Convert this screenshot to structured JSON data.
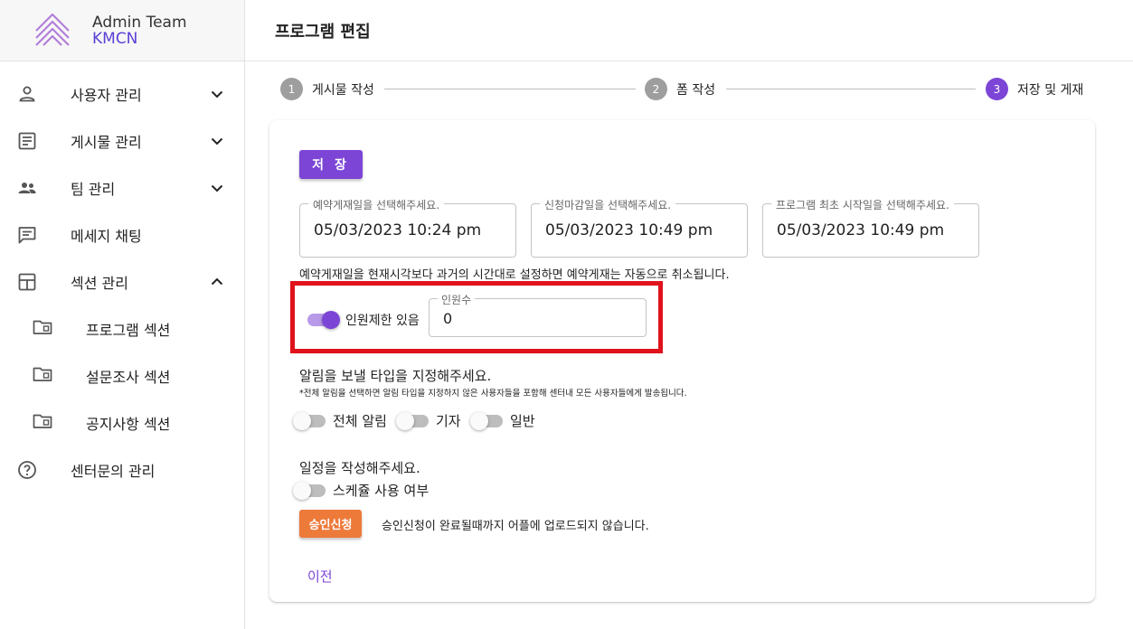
{
  "brand": {
    "title": "Admin Team",
    "subtitle": "KMCN"
  },
  "colors": {
    "accent": "#7c45d6",
    "approve": "#ee7a3a",
    "highlight": "#e0121c"
  },
  "sidebar": {
    "items": [
      {
        "label": "사용자 관리",
        "icon": "person-icon",
        "expanded": false
      },
      {
        "label": "게시물 관리",
        "icon": "article-icon",
        "expanded": false
      },
      {
        "label": "팀 관리",
        "icon": "group-icon",
        "expanded": false
      },
      {
        "label": "메세지 채팅",
        "icon": "chat-icon"
      },
      {
        "label": "섹션 관리",
        "icon": "dashboard-icon",
        "expanded": true
      },
      {
        "label": "센터문의 관리",
        "icon": "help-icon"
      }
    ],
    "sub_items": [
      {
        "label": "프로그램 섹션",
        "icon": "folder-icon"
      },
      {
        "label": "설문조사 섹션",
        "icon": "folder-icon"
      },
      {
        "label": "공지사항 섹션",
        "icon": "folder-icon"
      }
    ]
  },
  "header": {
    "title": "프로그램 편집"
  },
  "stepper": {
    "steps": [
      {
        "num": "1",
        "label": "게시물 작성",
        "state": "done"
      },
      {
        "num": "2",
        "label": "폼 작성",
        "state": "done"
      },
      {
        "num": "3",
        "label": "저장 및 게재",
        "state": "active"
      }
    ]
  },
  "form": {
    "save_label": "저 장",
    "fields": [
      {
        "label": "예약게재일을 선택해주세요.",
        "value": "05/03/2023 10:24 pm"
      },
      {
        "label": "신청마감일을 선택해주세요.",
        "value": "05/03/2023 10:49 pm"
      },
      {
        "label": "프로그램 최초 시작일을 선택해주세요.",
        "value": "05/03/2023 10:49 pm"
      }
    ],
    "notice": "예약게재일을 현재시각보다 과거의 시간대로 설정하면 예약게재는 자동으로 취소됩니다.",
    "limit_toggle": {
      "label": "인원제한 있음",
      "on": true
    },
    "count_field": {
      "label": "인원수",
      "value": "0"
    },
    "alert_title": "알림을 보낼 타입을 지정해주세요.",
    "alert_note": "*전체 알림을 선택하면 알림 타입을 지정하지 않은 사용자들을 포함해 센터내 모든 사용자들에게 발송됩니다.",
    "alert_toggles": [
      {
        "label": "전체 알림",
        "on": false
      },
      {
        "label": "기자",
        "on": false
      },
      {
        "label": "일반",
        "on": false
      }
    ],
    "schedule_title": "일정을 작성해주세요.",
    "schedule_toggle": {
      "label": "스케쥴 사용 여부",
      "on": false
    },
    "approve_label": "승인신청",
    "approve_note": "승인신청이 완료될때까지 어플에 업로드되지 않습니다.",
    "prev_label": "이전"
  }
}
